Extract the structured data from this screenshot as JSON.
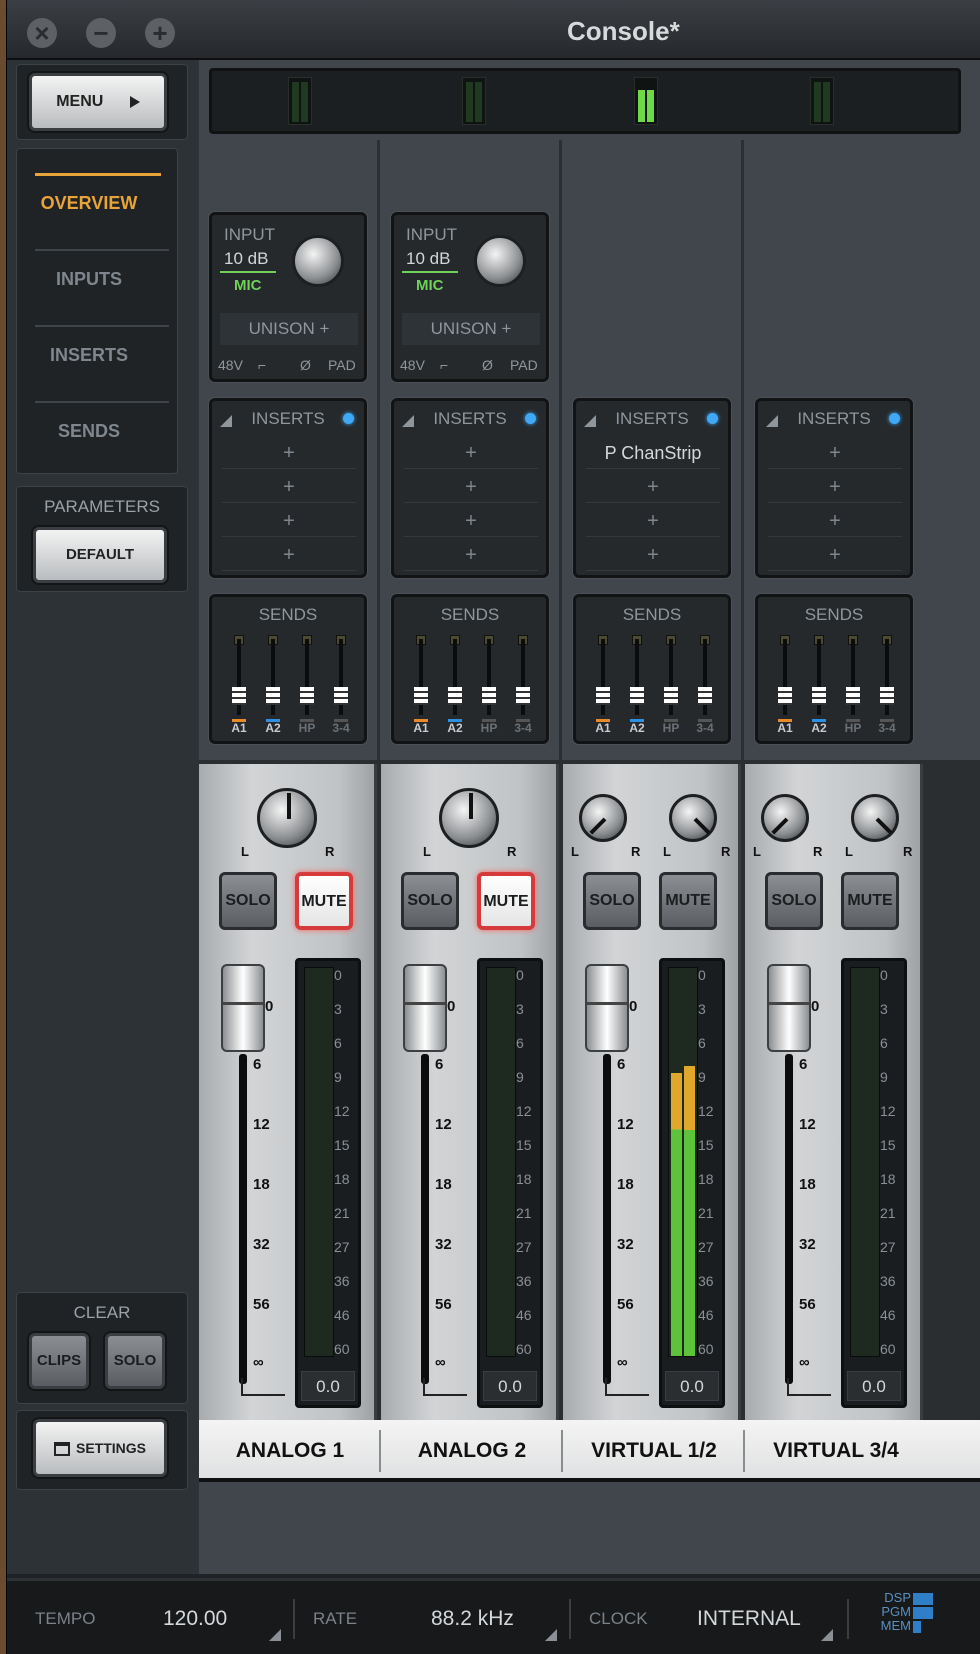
{
  "window": {
    "title": "Console*"
  },
  "sidebar": {
    "menu_label": "MENU",
    "nav": [
      {
        "label": "OVERVIEW",
        "active": true
      },
      {
        "label": "INPUTS",
        "active": false
      },
      {
        "label": "INSERTS",
        "active": false
      },
      {
        "label": "SENDS",
        "active": false
      }
    ],
    "parameters_label": "PARAMETERS",
    "default_label": "DEFAULT",
    "clear_label": "CLEAR",
    "clips_label": "CLIPS",
    "solo_label": "SOLO",
    "settings_label": "SETTINGS"
  },
  "channels": [
    {
      "name": "ANALOG 1",
      "input": {
        "label": "INPUT",
        "gain": "10 dB",
        "source": "MIC",
        "unison": "UNISON +",
        "toggles": [
          "48V",
          "",
          "Ø",
          "PAD"
        ]
      },
      "inserts_label": "INSERTS",
      "insert_slots": [
        "+",
        "+",
        "+",
        "+"
      ],
      "sends_label": "SENDS",
      "sends": [
        "A1",
        "A2",
        "HP",
        "3-4"
      ],
      "solo": "SOLO",
      "mute": "MUTE",
      "mute_active": true,
      "readout": "0.0",
      "meter_level": 0
    },
    {
      "name": "ANALOG 2",
      "input": {
        "label": "INPUT",
        "gain": "10 dB",
        "source": "MIC",
        "unison": "UNISON +",
        "toggles": [
          "48V",
          "",
          "Ø",
          "PAD"
        ]
      },
      "inserts_label": "INSERTS",
      "insert_slots": [
        "+",
        "+",
        "+",
        "+"
      ],
      "sends_label": "SENDS",
      "sends": [
        "A1",
        "A2",
        "HP",
        "3-4"
      ],
      "solo": "SOLO",
      "mute": "MUTE",
      "mute_active": true,
      "readout": "0.0",
      "meter_level": 0
    },
    {
      "name": "VIRTUAL 1/2",
      "inserts_label": "INSERTS",
      "insert_slots": [
        "P ChanStrip",
        "+",
        "+",
        "+"
      ],
      "sends_label": "SENDS",
      "sends": [
        "A1",
        "A2",
        "HP",
        "3-4"
      ],
      "solo": "SOLO",
      "mute": "MUTE",
      "mute_active": false,
      "readout": "0.0",
      "meter_level": 0.85
    },
    {
      "name": "VIRTUAL 3/4",
      "inserts_label": "INSERTS",
      "insert_slots": [
        "+",
        "+",
        "+",
        "+"
      ],
      "sends_label": "SENDS",
      "sends": [
        "A1",
        "A2",
        "HP",
        "3-4"
      ],
      "solo": "SOLO",
      "mute": "MUTE",
      "mute_active": false,
      "readout": "0.0",
      "meter_level": 0
    }
  ],
  "pan": {
    "left": "L",
    "right": "R"
  },
  "fader_scale": [
    "0",
    "6",
    "12",
    "18",
    "32",
    "56",
    "∞"
  ],
  "meter_scale": [
    "0",
    "3",
    "6",
    "9",
    "12",
    "15",
    "18",
    "21",
    "27",
    "36",
    "46",
    "60"
  ],
  "status": {
    "tempo_label": "TEMPO",
    "tempo_value": "120.00",
    "rate_label": "RATE",
    "rate_value": "88.2 kHz",
    "clock_label": "CLOCK",
    "clock_value": "INTERNAL",
    "dsp_labels": [
      "DSP",
      "PGM",
      "MEM"
    ]
  },
  "colors": {
    "accent": "#e8a33a",
    "mic": "#6fd05a",
    "send_a1": "#e8892a",
    "send_a2": "#2f8fe0",
    "mute_ring": "#d63a3a",
    "meter_green": "#5cc33a",
    "meter_yellow": "#e0a82a"
  }
}
